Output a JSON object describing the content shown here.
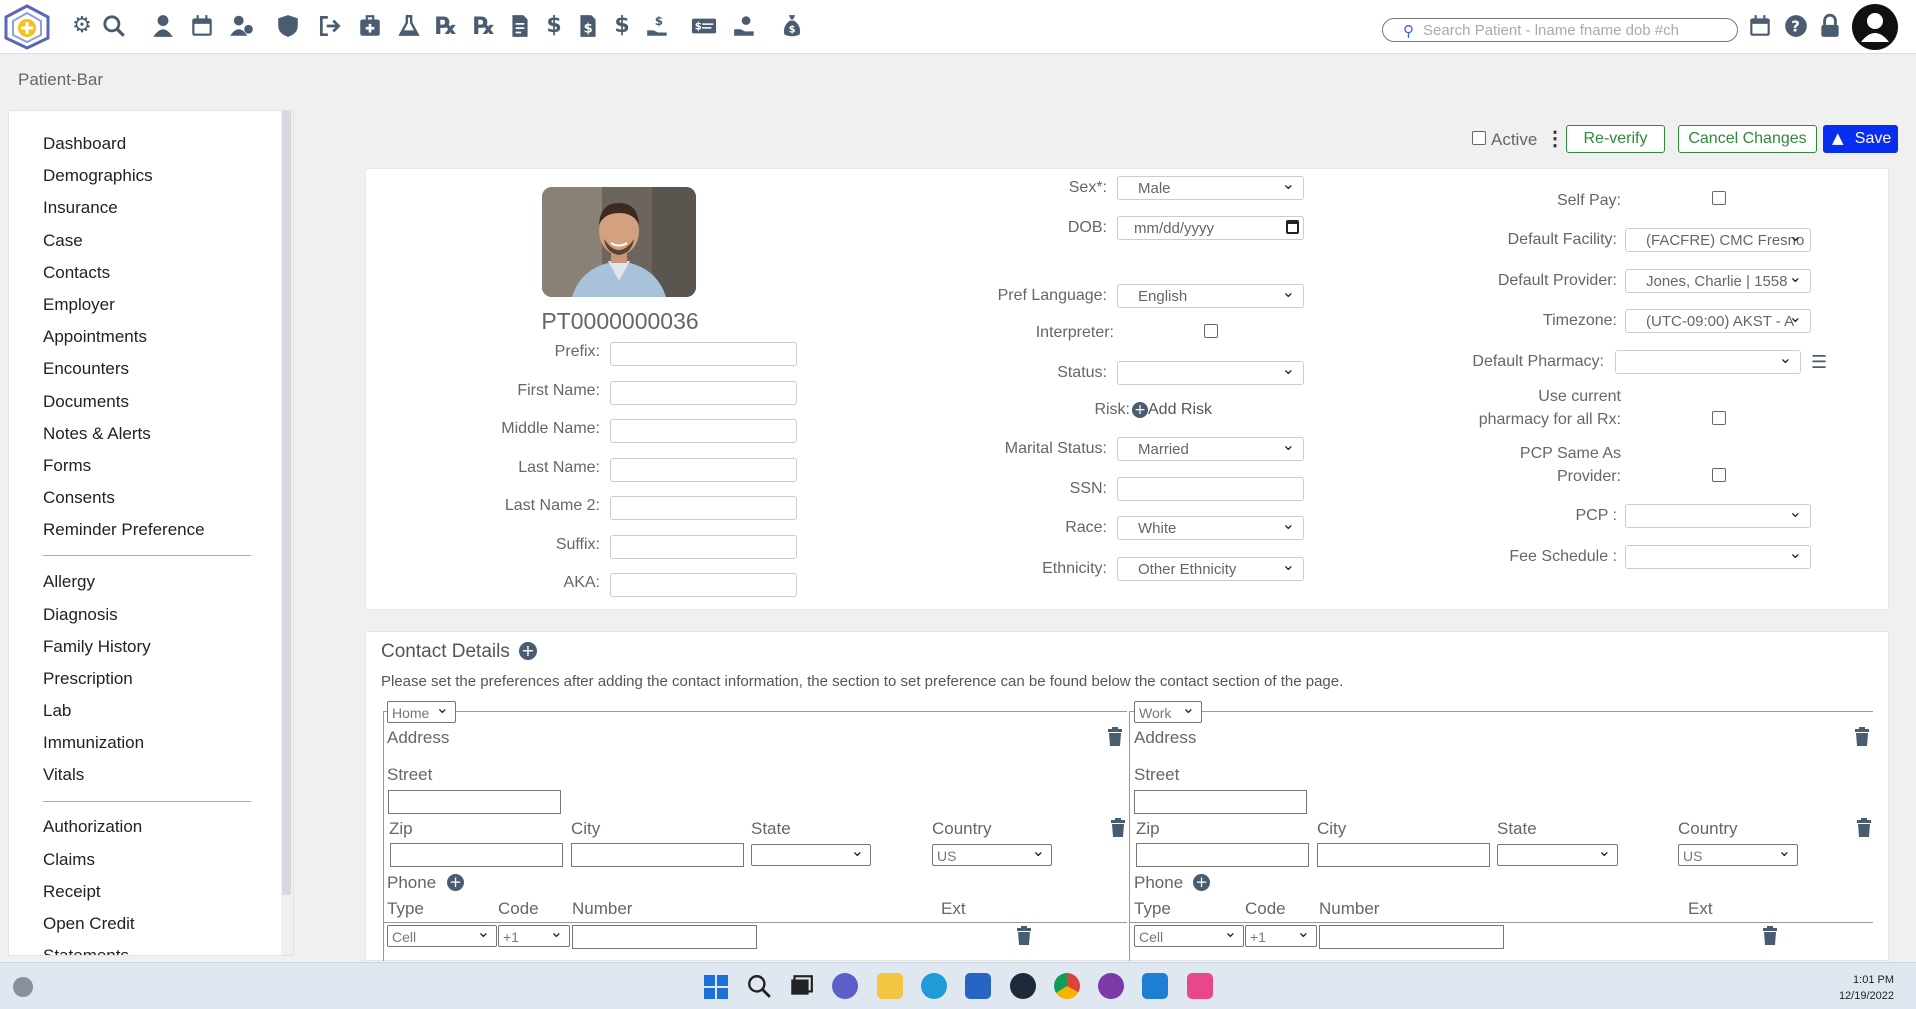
{
  "toolbar": {
    "search_placeholder": "Search Patient - lname fname dob #ch",
    "icons": [
      "gear-icon",
      "search-icon",
      "user-icon",
      "calendar-icon",
      "user-group-icon",
      "shield-icon",
      "sign-out-icon",
      "medical-kit-icon",
      "flask-icon",
      "rx-icon",
      "rx-alt-icon",
      "document-icon",
      "dollar-icon",
      "document-dollar-icon",
      "dollar-alt-icon",
      "hand-holding-dollar-icon",
      "money-card-icon",
      "hand-coins-icon",
      "money-bag-icon"
    ],
    "right_icons": [
      "calendar-icon",
      "help-icon",
      "lock-icon",
      "account-icon"
    ]
  },
  "patient_bar": {
    "title": "Patient-Bar"
  },
  "sidebar": {
    "group1": [
      "Dashboard",
      "Demographics",
      "Insurance",
      "Case",
      "Contacts",
      "Employer",
      "Appointments",
      "Encounters",
      "Documents",
      "Notes & Alerts",
      "Forms",
      "Consents",
      "Reminder Preference"
    ],
    "group2": [
      "Allergy",
      "Diagnosis",
      "Family History",
      "Prescription",
      "Lab",
      "Immunization",
      "Vitals"
    ],
    "group3": [
      "Authorization",
      "Claims",
      "Receipt",
      "Open Credit",
      "Statements"
    ]
  },
  "actions": {
    "active_label": "Active",
    "reverify_label": "Re-verify",
    "cancel_label": "Cancel Changes",
    "save_label": "Save"
  },
  "patient": {
    "id": "PT0000000036",
    "labels": {
      "prefix": "Prefix:",
      "first_name": "First Name:",
      "middle_name": "Middle Name:",
      "last_name": "Last Name:",
      "last_name2": "Last Name 2:",
      "suffix": "Suffix:",
      "aka": "AKA:"
    }
  },
  "demographics": {
    "sex_label": "Sex*:",
    "sex_value": "Male",
    "dob_label": "DOB:",
    "dob_placeholder": "mm/dd/yyyy",
    "language_label": "Pref Language:",
    "language_value": "English",
    "interpreter_label": "Interpreter:",
    "status_label": "Status:",
    "status_value": "",
    "risk_label": "Risk:",
    "add_risk_label": "Add Risk",
    "marital_label": "Marital Status:",
    "marital_value": "Married",
    "ssn_label": "SSN:",
    "race_label": "Race:",
    "race_value": "White",
    "ethnicity_label": "Ethnicity:",
    "ethnicity_value": "Other Ethnicity"
  },
  "preferences": {
    "self_pay_label": "Self Pay:",
    "facility_label": "Default Facility:",
    "facility_value": "(FACFRE) CMC Fresno",
    "provider_label": "Default Provider:",
    "provider_value": "Jones, Charlie | 1558",
    "timezone_label": "Timezone:",
    "timezone_value": "(UTC-09:00) AKST - A",
    "pharmacy_label": "Default Pharmacy:",
    "pharmacy_value": "",
    "use_pharmacy_label_1": "Use current",
    "use_pharmacy_label_2": "pharmacy for all Rx:",
    "pcp_same_label_1": "PCP Same As",
    "pcp_same_label_2": "Provider:",
    "pcp_label": "PCP :",
    "pcp_value": "",
    "fee_label": "Fee Schedule :",
    "fee_value": ""
  },
  "contact": {
    "title": "Contact Details",
    "note": "Please set the preferences after adding the contact information, the section to set preference can be found below the contact section of the page.",
    "blocks": [
      {
        "type_value": "Home",
        "address_label": "Address",
        "street_label": "Street",
        "zip_label": "Zip",
        "city_label": "City",
        "state_label": "State",
        "country_label": "Country",
        "country_value": "US",
        "phone_label": "Phone",
        "type_label": "Type",
        "code_label": "Code",
        "number_label": "Number",
        "ext_label": "Ext",
        "phone_type_value": "Cell",
        "code_value": "+1"
      },
      {
        "type_value": "Work",
        "address_label": "Address",
        "street_label": "Street",
        "zip_label": "Zip",
        "city_label": "City",
        "state_label": "State",
        "country_label": "Country",
        "country_value": "US",
        "phone_label": "Phone",
        "type_label": "Type",
        "code_label": "Code",
        "number_label": "Number",
        "ext_label": "Ext",
        "phone_type_value": "Cell",
        "code_value": "+1"
      }
    ]
  },
  "taskbar": {
    "time": "1:01 PM",
    "date": "12/19/2022",
    "icons": [
      "windows-start-icon",
      "search-icon",
      "task-view-icon",
      "chat-icon",
      "file-explorer-icon",
      "edge-icon",
      "store-icon",
      "app-a-icon",
      "chrome-icon",
      "app-purple-icon",
      "vscode-icon",
      "snipping-tool-icon"
    ]
  },
  "colors": {
    "accent_blue": "#0a2ef0",
    "accent_green": "#2f8a3a",
    "icon_slate": "#4a5c70"
  }
}
